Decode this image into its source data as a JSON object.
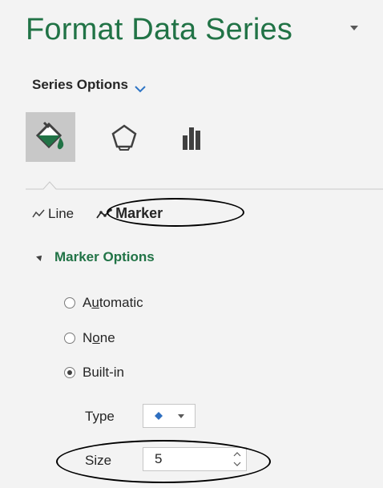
{
  "pane": {
    "title": "Format Data Series",
    "series_options_label": "Series Options"
  },
  "tabs": [
    {
      "name": "fill-line-tab",
      "icon": "paint-bucket-icon",
      "selected": true
    },
    {
      "name": "effects-tab",
      "icon": "pentagon-icon",
      "selected": false
    },
    {
      "name": "series-options-tab",
      "icon": "bar-chart-icon",
      "selected": false
    }
  ],
  "subtabs": {
    "line_label": "Line",
    "marker_label": "Marker"
  },
  "marker_options": {
    "header": "Marker Options",
    "automatic_pre": "A",
    "automatic_u": "u",
    "automatic_post": "tomatic",
    "none_pre": "N",
    "none_u": "o",
    "none_post": "ne",
    "builtin_label": "Built-in",
    "selected": "Built-in",
    "type_label": "Type",
    "type_value_icon": "diamond-marker-icon",
    "size_label": "Size",
    "size_value": "5"
  },
  "colors": {
    "accent_green": "#217346",
    "marker_blue": "#2e6fc0"
  }
}
